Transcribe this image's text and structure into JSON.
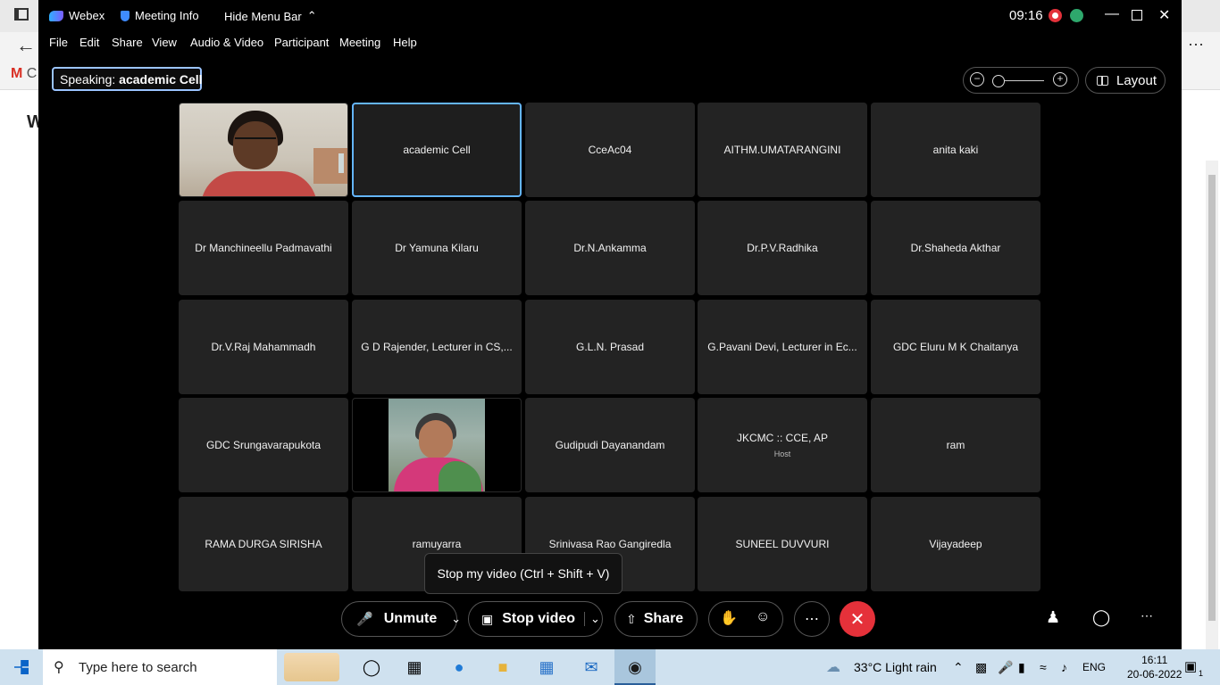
{
  "browser": {
    "gmail_letter": "M",
    "partial_text": "C",
    "page_letter": "W"
  },
  "titlebar": {
    "app_name": "Webex",
    "meeting_info": "Meeting Info",
    "hide_menu_bar": "Hide Menu Bar",
    "time": "09:16"
  },
  "menu": [
    "File",
    "Edit",
    "Share",
    "View",
    "Audio & Video",
    "Participant",
    "Meeting",
    "Help"
  ],
  "speaking": {
    "prefix": "Speaking: ",
    "name": "academic Cell"
  },
  "layout_label": "Layout",
  "participants": [
    {
      "name": "",
      "video": true,
      "kind": "woman-glasses"
    },
    {
      "name": "academic Cell",
      "active": true
    },
    {
      "name": "CceAc04"
    },
    {
      "name": "AITHM.UMATARANGINI"
    },
    {
      "name": "anita kaki"
    },
    {
      "name": "Dr Manchineellu Padmavathi"
    },
    {
      "name": "Dr Yamuna Kilaru"
    },
    {
      "name": "Dr.N.Ankamma"
    },
    {
      "name": "Dr.P.V.Radhika"
    },
    {
      "name": "Dr.Shaheda Akthar"
    },
    {
      "name": "Dr.V.Raj Mahammadh"
    },
    {
      "name": "G D Rajender, Lecturer in CS,..."
    },
    {
      "name": "G.L.N. Prasad"
    },
    {
      "name": "G.Pavani Devi, Lecturer in Ec..."
    },
    {
      "name": "GDC Eluru M K Chaitanya"
    },
    {
      "name": "GDC Srungavarapukota"
    },
    {
      "name": "",
      "video": true,
      "kind": "woman-sari"
    },
    {
      "name": "Gudipudi Dayanandam"
    },
    {
      "name": "JKCMC :: CCE, AP",
      "host": "Host"
    },
    {
      "name": "ram"
    },
    {
      "name": "RAMA DURGA SIRISHA"
    },
    {
      "name": "ramuyarra"
    },
    {
      "name": "Srinivasa Rao Gangiredla"
    },
    {
      "name": "SUNEEL DUVVURI"
    },
    {
      "name": "Vijayadeep"
    }
  ],
  "tooltip": "Stop my video (Ctrl + Shift + V)",
  "controls": {
    "unmute": "Unmute",
    "stop_video": "Stop video",
    "share": "Share"
  },
  "taskbar": {
    "search_placeholder": "Type here to search",
    "weather": "33°C  Light rain",
    "lang": "ENG",
    "time": "16:11",
    "date": "20-06-2022",
    "notif_count": "1"
  }
}
